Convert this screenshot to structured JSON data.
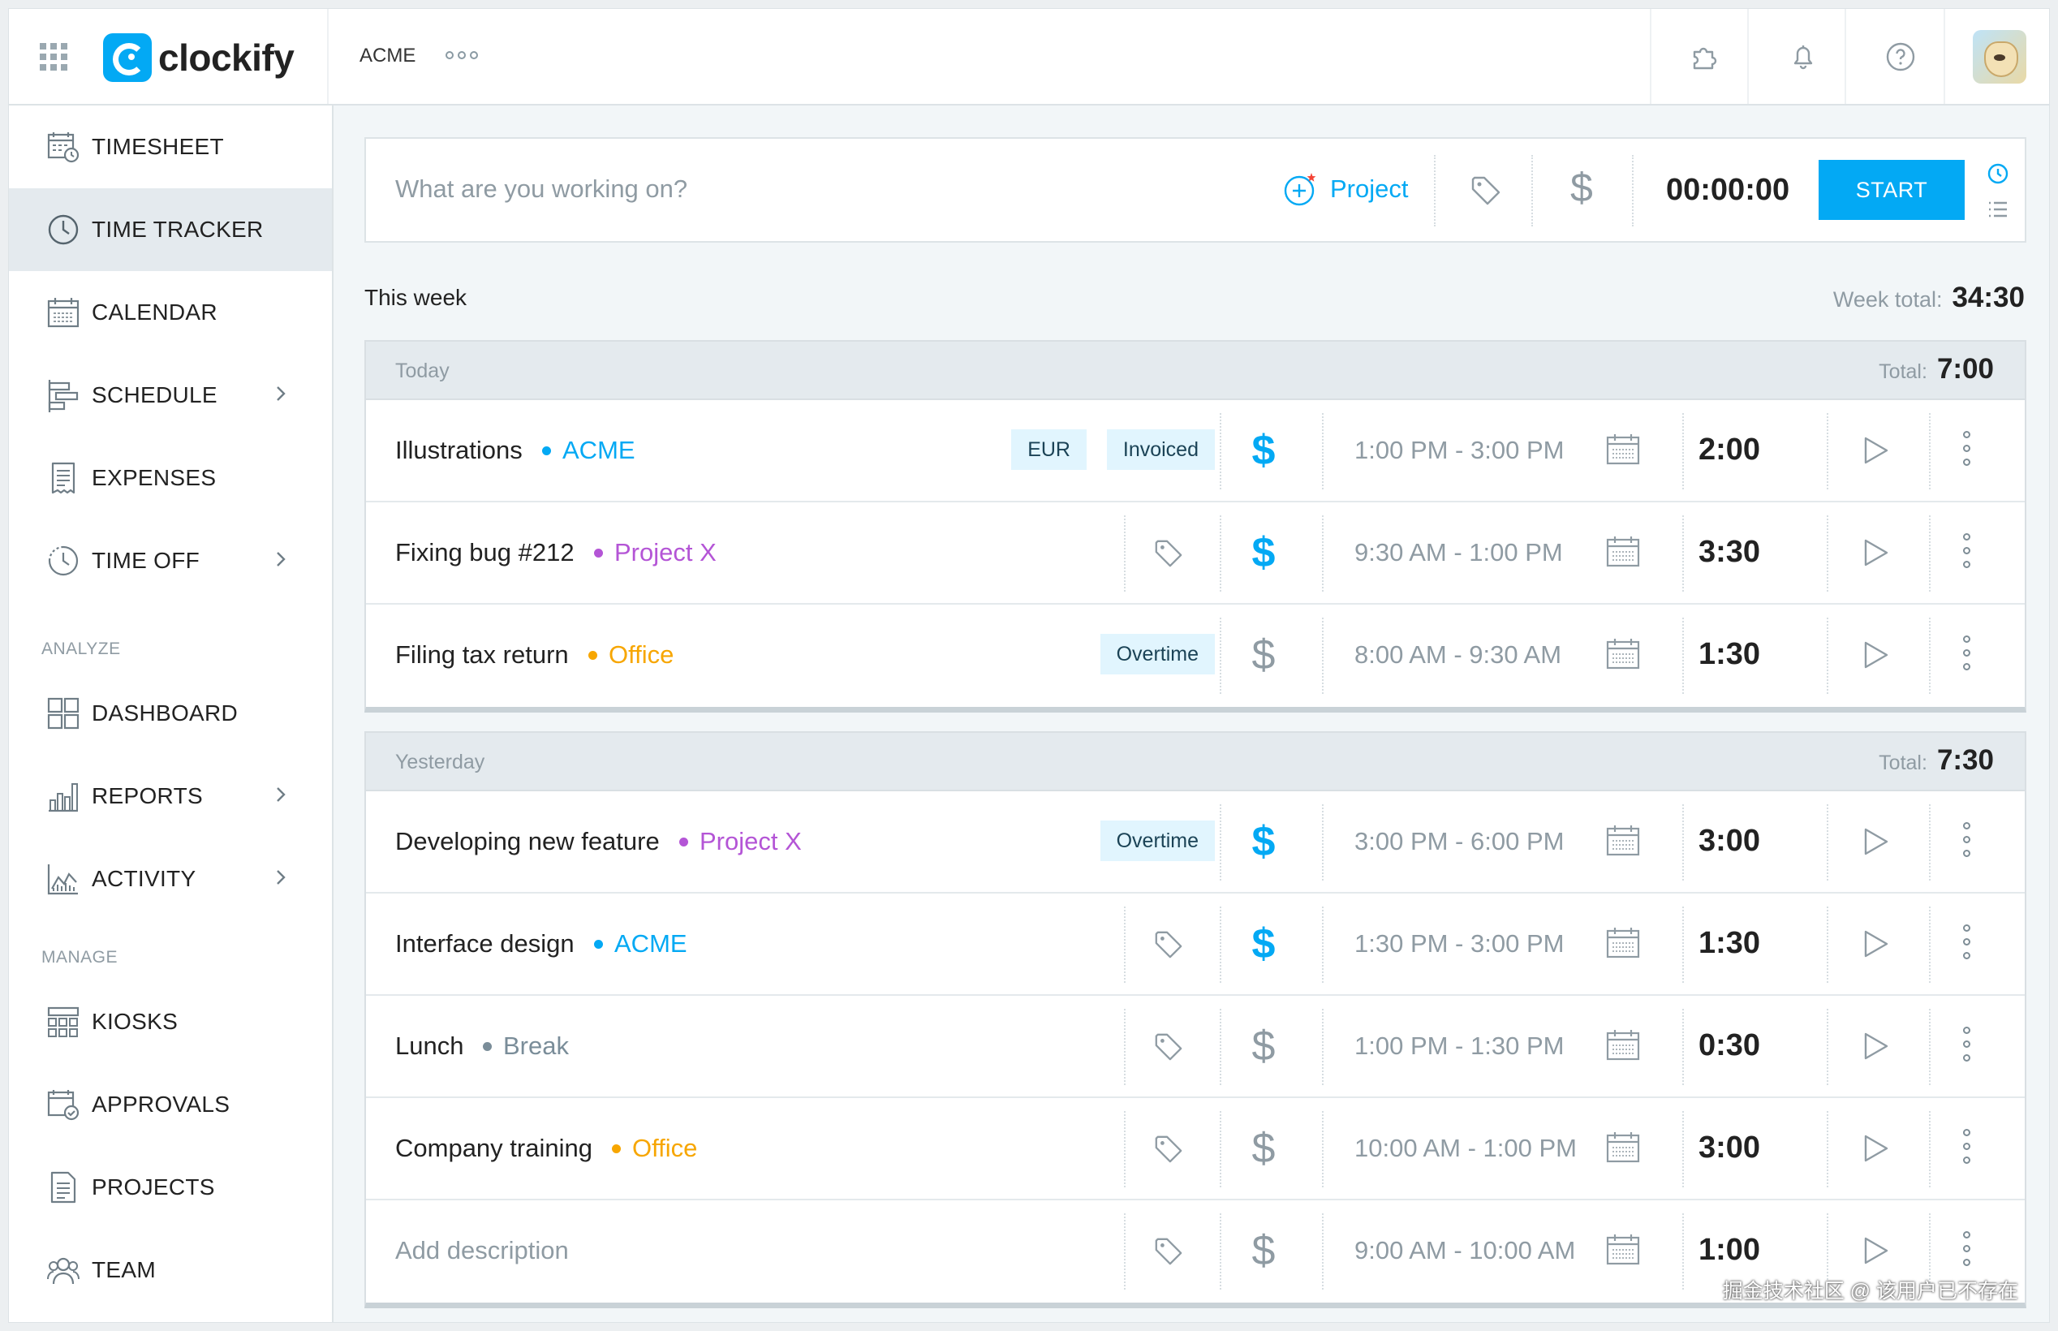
{
  "app": {
    "name": "clockify",
    "workspace": "ACME"
  },
  "sidebar": {
    "items": [
      {
        "label": "TIMESHEET",
        "icon": "timesheet-icon"
      },
      {
        "label": "TIME TRACKER",
        "icon": "clock-icon",
        "active": true
      },
      {
        "label": "CALENDAR",
        "icon": "calendar-icon"
      },
      {
        "label": "SCHEDULE",
        "icon": "schedule-icon",
        "has_submenu": true
      },
      {
        "label": "EXPENSES",
        "icon": "receipt-icon"
      },
      {
        "label": "TIME OFF",
        "icon": "time-off-icon",
        "has_submenu": true
      },
      {
        "label": "DASHBOARD",
        "icon": "dashboard-icon"
      },
      {
        "label": "REPORTS",
        "icon": "reports-icon",
        "has_submenu": true
      },
      {
        "label": "ACTIVITY",
        "icon": "activity-icon",
        "has_submenu": true
      },
      {
        "label": "KIOSKS",
        "icon": "kiosk-icon"
      },
      {
        "label": "APPROVALS",
        "icon": "approvals-icon"
      },
      {
        "label": "PROJECTS",
        "icon": "projects-icon"
      },
      {
        "label": "TEAM",
        "icon": "team-icon"
      }
    ],
    "sections": {
      "analyze": "ANALYZE",
      "manage": "MANAGE"
    }
  },
  "tracker": {
    "placeholder": "What are you working on?",
    "project_label": "Project",
    "timer": "00:00:00",
    "start_label": "START"
  },
  "week": {
    "label": "This week",
    "total_label": "Week total:",
    "total": "34:30"
  },
  "colors": {
    "accent": "#03a9f4",
    "acme": "#03a9f4",
    "project_x": "#b455d6",
    "office": "#f7a600",
    "break": "#7a8d99"
  },
  "days": [
    {
      "name": "Today",
      "total_label": "Total:",
      "total": "7:00",
      "entries": [
        {
          "description": "Illustrations",
          "project": "ACME",
          "badges": [
            "EUR",
            "Invoiced"
          ],
          "billable": true,
          "time_range": "1:00 PM - 3:00 PM",
          "duration": "2:00"
        },
        {
          "description": "Fixing bug #212",
          "project": "Project X",
          "badges": [],
          "billable": true,
          "time_range": "9:30 AM - 1:00 PM",
          "duration": "3:30"
        },
        {
          "description": "Filing tax return",
          "project": "Office",
          "badges": [
            "Overtime"
          ],
          "billable": false,
          "time_range": "8:00 AM - 9:30 AM",
          "duration": "1:30"
        }
      ]
    },
    {
      "name": "Yesterday",
      "total_label": "Total:",
      "total": "7:30",
      "entries": [
        {
          "description": "Developing new feature",
          "project": "Project X",
          "badges": [
            "Overtime"
          ],
          "billable": true,
          "time_range": "3:00 PM - 6:00 PM",
          "duration": "3:00"
        },
        {
          "description": "Interface design",
          "project": "ACME",
          "badges": [],
          "billable": true,
          "time_range": "1:30 PM - 3:00 PM",
          "duration": "1:30"
        },
        {
          "description": "Lunch",
          "project": "Break",
          "badges": [],
          "billable": false,
          "time_range": "1:00 PM - 1:30 PM",
          "duration": "0:30"
        },
        {
          "description": "Company training",
          "project": "Office",
          "badges": [],
          "billable": false,
          "time_range": "10:00 AM - 1:00 PM",
          "duration": "3:00"
        },
        {
          "description": "",
          "placeholder": "Add description",
          "project": "",
          "badges": [],
          "billable": false,
          "time_range": "9:00 AM - 10:00 AM",
          "duration": "1:00"
        }
      ]
    }
  ],
  "watermark": "掘金技术社区 @ 该用户已不存在"
}
